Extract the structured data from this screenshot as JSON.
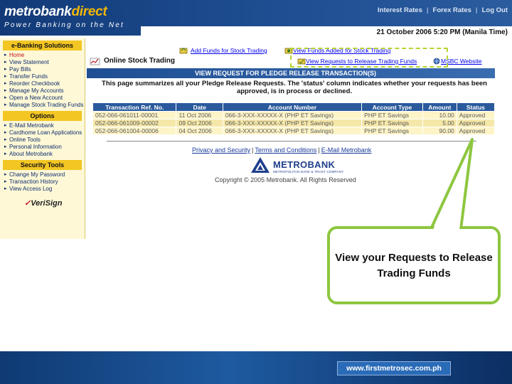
{
  "header": {
    "logo_main": "metrobank",
    "logo_accent": "direct",
    "tagline": "Power Banking on the Net",
    "links": [
      "Interest Rates",
      "Forex Rates",
      "Log Out"
    ]
  },
  "datetime": "21 October 2006 5:20 PM (Manila Time)",
  "sidebar": {
    "ebanking_title": "e-Banking Solutions",
    "ebanking_items": [
      {
        "label": "Home",
        "active": true
      },
      {
        "label": "View Statement"
      },
      {
        "label": "Pay Bills"
      },
      {
        "label": "Transfer Funds"
      },
      {
        "label": "Reorder Checkbook"
      },
      {
        "label": "Manage My Accounts"
      },
      {
        "label": "Open a New Account"
      },
      {
        "label": "Manage Stock Trading Funds"
      }
    ],
    "options_title": "Options",
    "options_items": [
      {
        "label": "E-Mail Metrobank"
      },
      {
        "label": "Cardhome Loan Applications"
      },
      {
        "label": "Online Tools"
      },
      {
        "label": "Personal Information"
      },
      {
        "label": "About Metrobank"
      }
    ],
    "security_title": "Security Tools",
    "security_items": [
      {
        "label": "Change My Password"
      },
      {
        "label": "Transaction History"
      },
      {
        "label": "View Access Log"
      }
    ],
    "verisign_label": "VeriSign"
  },
  "quick_links": {
    "add_funds": "Add Funds for Stock Trading",
    "view_funds_added": "View Funds Added for Stock Trading",
    "view_requests": "View Requests to Release Trading Funds",
    "msbc": "MSBC Website"
  },
  "section_title": "Online Stock Trading",
  "page_title": "VIEW REQUEST FOR PLEDGE RELEASE TRANSACTION(S)",
  "intro": "This page summarizes all your Pledge Release Requests. The 'status' column indicates whether your requests has been approved, is in process or declined.",
  "table": {
    "headers": [
      "Transaction Ref. No.",
      "Date",
      "Account Number",
      "Account Type",
      "Amount",
      "Status"
    ],
    "rows": [
      [
        "052-066-061011-00001",
        "11 Oct 2006",
        "066-3-XXX-XXXXX-X (PHP ET Savings)",
        "PHP ET Savings",
        "10.00",
        "Approved"
      ],
      [
        "052-066-061009-00002",
        "09 Oct 2006",
        "066-3-XXX-XXXXX-X (PHP ET Savings)",
        "PHP ET Savings",
        "5.00",
        "Approved"
      ],
      [
        "052-066-061004-00006",
        "04 Oct 2006",
        "066-3-XXX-XXXXX-X (PHP ET Savings)",
        "PHP ET Savings",
        "90.00",
        "Approved"
      ]
    ]
  },
  "footer": {
    "links": [
      "Privacy and Security",
      "Terms and Conditions",
      "E-Mail Metrobank"
    ],
    "brand": "METROBANK",
    "brand_sub": "METROPOLITAN BANK & TRUST COMPANY",
    "copyright": "Copyright © 2005 Metrobank. All Rights Reserved"
  },
  "callout_text": "View your Requests to Release Trading Funds",
  "bottom_url": "www.firstmetrosec.com.ph",
  "colors": {
    "header_blue": "#1f4f92",
    "sidebar_yellow": "#f3c623",
    "callout_green": "#8dc63f"
  }
}
